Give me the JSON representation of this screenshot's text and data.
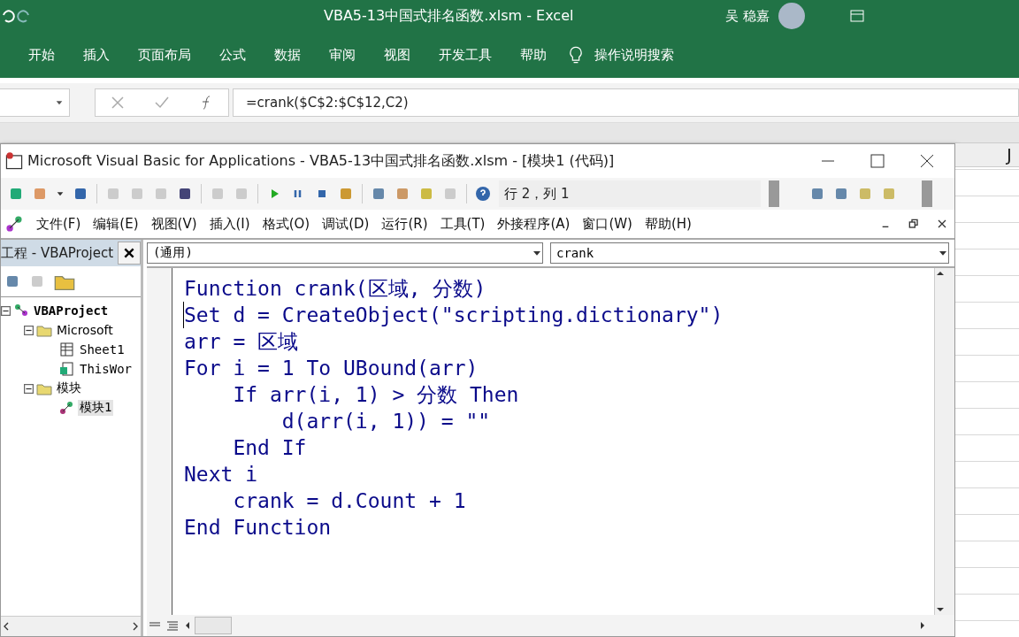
{
  "excel": {
    "title": "VBA5-13中国式排名函数.xlsm  -  Excel",
    "user": "吴 稳嘉",
    "ribbon_tabs": [
      {
        "label": "开始"
      },
      {
        "label": "插入"
      },
      {
        "label": "页面布局"
      },
      {
        "label": "公式"
      },
      {
        "label": "数据"
      },
      {
        "label": "审阅"
      },
      {
        "label": "视图"
      },
      {
        "label": "开发工具"
      },
      {
        "label": "帮助"
      }
    ],
    "search": "操作说明搜索",
    "formula": "=crank($C$2:$C$12,C2)",
    "column_header": "J"
  },
  "vba": {
    "title": "Microsoft Visual Basic for Applications - VBA5-13中国式排名函数.xlsm - [模块1 (代码)]",
    "position": "行 2，列 1",
    "menu": [
      "文件(F)",
      "编辑(E)",
      "视图(V)",
      "插入(I)",
      "格式(O)",
      "调试(D)",
      "运行(R)",
      "工具(T)",
      "外接程序(A)",
      "窗口(W)",
      "帮助(H)"
    ],
    "project": {
      "title": "工程 - VBAProject",
      "tree": [
        {
          "label": "VBAProject",
          "kind": "project",
          "expanded": true,
          "selected": false,
          "children": [
            {
              "label": "Microsoft",
              "kind": "folder",
              "expanded": true,
              "selected": false,
              "children": [
                {
                  "label": "Sheet1",
                  "kind": "sheet",
                  "selected": false
                },
                {
                  "label": "ThisWor",
                  "kind": "workbook",
                  "selected": false
                }
              ]
            },
            {
              "label": "模块",
              "kind": "folder",
              "expanded": true,
              "selected": false,
              "children": [
                {
                  "label": "模块1",
                  "kind": "module",
                  "selected": true
                }
              ]
            }
          ]
        }
      ]
    },
    "code": {
      "object": "(通用)",
      "procedure": "crank",
      "lines": [
        {
          "text": "Function crank(区域, 分数)",
          "cursor": false
        },
        {
          "text": "Set d = CreateObject(\"scripting.dictionary\")",
          "cursor": true
        },
        {
          "text": "arr = 区域",
          "cursor": false
        },
        {
          "text": "For i = 1 To UBound(arr)",
          "cursor": false
        },
        {
          "text": "    If arr(i, 1) > 分数 Then",
          "cursor": false
        },
        {
          "text": "        d(arr(i, 1)) = \"\"",
          "cursor": false
        },
        {
          "text": "    End If",
          "cursor": false
        },
        {
          "text": "Next i",
          "cursor": false
        },
        {
          "text": "    crank = d.Count + 1",
          "cursor": false
        },
        {
          "text": "End Function",
          "cursor": false
        }
      ]
    }
  }
}
